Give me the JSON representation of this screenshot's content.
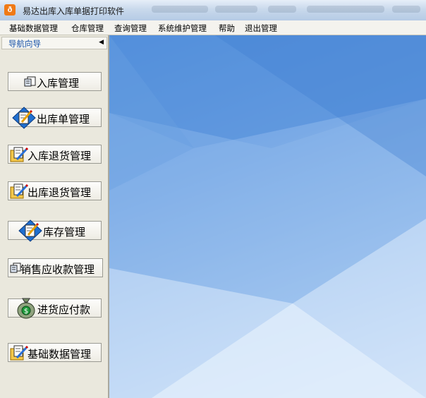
{
  "window": {
    "title": "易达出库入库单据打印软件"
  },
  "menu": {
    "items": [
      "基础数据管理",
      "仓库管理",
      "查询管理",
      "系统维护管理",
      "帮助",
      "退出管理"
    ]
  },
  "nav": {
    "header": "导航向导",
    "buttons": [
      {
        "label": "入库管理",
        "icon": "document-stack-icon"
      },
      {
        "label": "出库单管理",
        "icon": "edit-document-icon"
      },
      {
        "label": "入库退货管理",
        "icon": "folder-edit-icon"
      },
      {
        "label": "出库退货管理",
        "icon": "folder-edit-icon"
      },
      {
        "label": "库存管理",
        "icon": "edit-document-icon"
      },
      {
        "label": "销售应收款管理",
        "icon": "document-stack-icon"
      },
      {
        "label": "进货应付款",
        "icon": "money-bag-icon"
      },
      {
        "label": "基础数据管理",
        "icon": "folder-edit-icon"
      }
    ]
  },
  "colors": {
    "accent": "#1550a8",
    "main_bg": "#6fa3e4",
    "app_icon": "#f07a16"
  }
}
